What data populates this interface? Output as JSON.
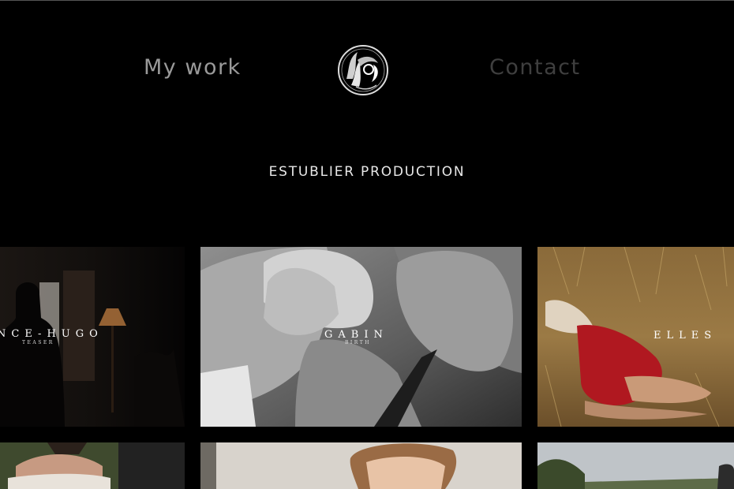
{
  "header": {
    "nav_left": "My work",
    "nav_right": "Contact",
    "logo_icon": "tree-circle-logo-icon"
  },
  "main": {
    "title": "ESTUBLIER PRODUCTION"
  },
  "gallery": {
    "items": [
      {
        "title": "NCE-HUGO",
        "subtitle": "TEASER"
      },
      {
        "title": "GABIN",
        "subtitle": "BIRTH"
      },
      {
        "title": "ELLES",
        "subtitle": ""
      },
      {
        "title": "",
        "subtitle": ""
      },
      {
        "title": "",
        "subtitle": ""
      },
      {
        "title": "",
        "subtitle": ""
      }
    ]
  },
  "colors": {
    "background": "#000000",
    "nav_active": "#9a9a9a",
    "nav_inactive": "#3f3f3f",
    "title": "#e8e8e8"
  }
}
